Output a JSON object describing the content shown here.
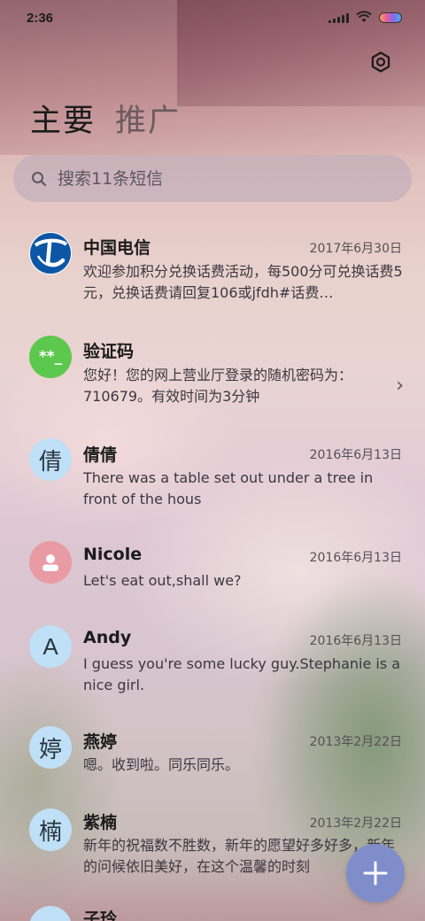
{
  "status_bar": {
    "time": "2:36",
    "icons": [
      "signal-icon",
      "wifi-icon",
      "battery-icon"
    ]
  },
  "header": {
    "settings_icon": "gear-icon",
    "tabs": [
      {
        "label": "主要",
        "active": true
      },
      {
        "label": "推广",
        "active": false
      }
    ]
  },
  "search": {
    "icon": "search-icon",
    "placeholder": "搜索11条短信"
  },
  "conversations": [
    {
      "sender": "中国电信",
      "date": "2017年6月30日",
      "preview": "欢迎参加积分兑换话费活动，每500分可兑换话费5元，兑换话费请回复106或jfdh#话费…",
      "avatar_type": "telecom-logo",
      "avatar_bg": "#ffffff"
    },
    {
      "sender": "验证码",
      "date": "",
      "preview": "您好！您的网上营业厅登录的随机密码为：710679。有效时间为3分钟",
      "avatar_text": "**_",
      "avatar_bg": "#5cc84e",
      "has_chevron": true
    },
    {
      "sender": "倩倩",
      "date": "2016年6月13日",
      "preview": "There was a table set out under a tree in front of the hous",
      "avatar_text": "倩",
      "avatar_bg": "#bfe0f6"
    },
    {
      "sender": "Nicole",
      "date": "2016年6月13日",
      "preview": "Let's eat out,shall we?",
      "avatar_type": "person-icon",
      "avatar_bg": "#e99ba3"
    },
    {
      "sender": "Andy",
      "date": "2016年6月13日",
      "preview": "I guess you're some lucky guy.Stephanie is a nice girl.",
      "avatar_text": "A",
      "avatar_bg": "#bfe0f6"
    },
    {
      "sender": "燕婷",
      "date": "2013年2月22日",
      "preview": "嗯。收到啦。同乐同乐。",
      "avatar_text": "婷",
      "avatar_bg": "#bfe0f6"
    },
    {
      "sender": "紫楠",
      "date": "2013年2月22日",
      "preview": "新年的祝福数不胜数，新年的愿望好多好多，新年的问候依旧美好，在这个温馨的时刻",
      "avatar_text": "楠",
      "avatar_bg": "#bfe0f6"
    },
    {
      "sender": "子玲",
      "date": "",
      "preview": "",
      "avatar_text": "",
      "avatar_bg": "#bfe0f6"
    }
  ],
  "fab": {
    "icon": "plus-icon"
  },
  "colors": {
    "accent": "#7f8ecb",
    "search_bg": "#b9aab9"
  }
}
